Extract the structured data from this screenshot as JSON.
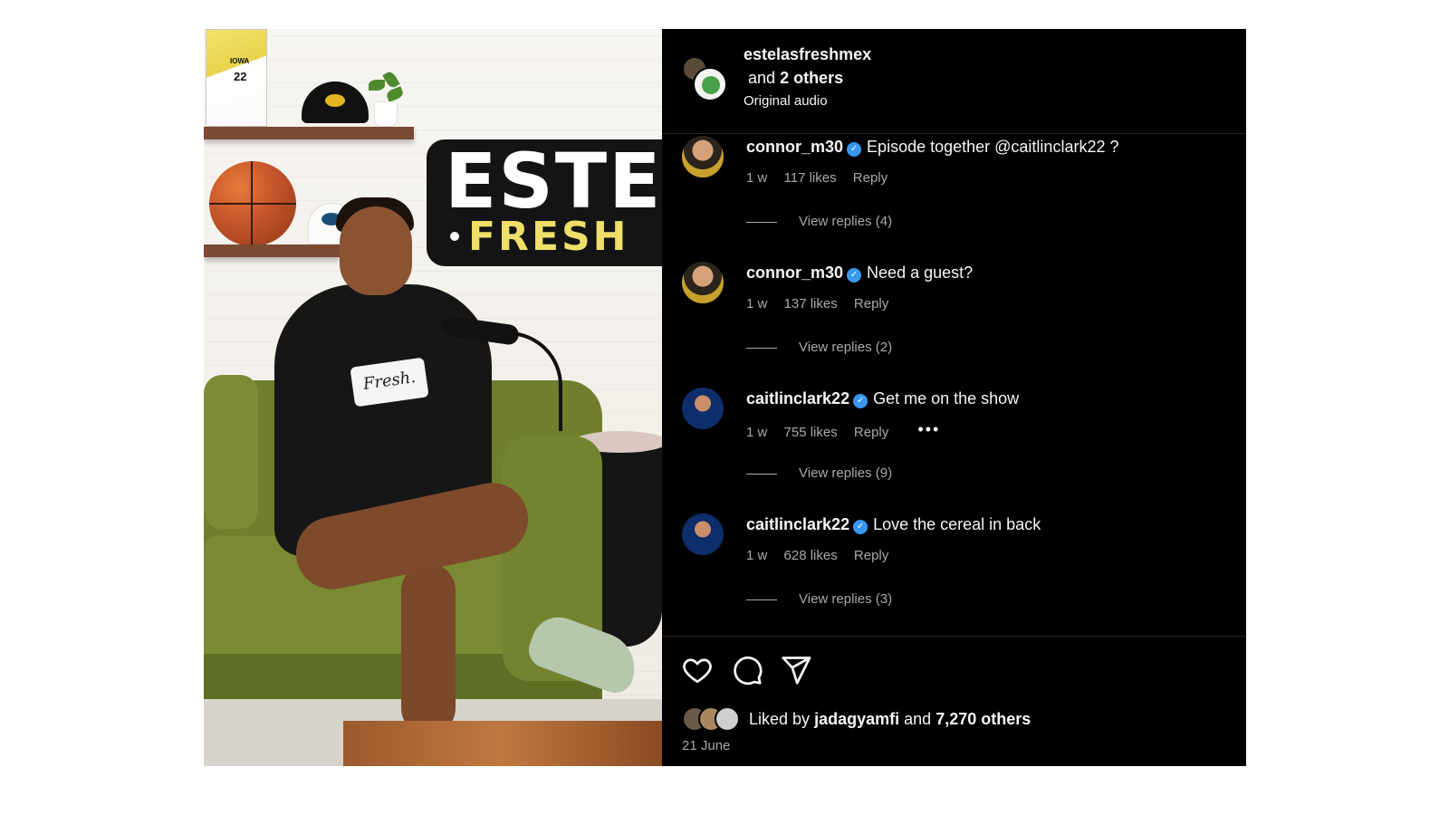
{
  "media": {
    "sign_big": "ESTE",
    "sign_small": "FRESH",
    "patch_text": "Fresh.",
    "magazine_number": "22",
    "magazine_team": "IOWA"
  },
  "post": {
    "author": "estelasfreshmex",
    "coauthors_prefix": "and",
    "coauthors_count": "2 others",
    "audio": "Original audio"
  },
  "comments": [
    {
      "user": "connor_m30",
      "text": "Episode together @caitlinclark22 ?",
      "age": "1 w",
      "likes": "117 likes",
      "reply_label": "Reply",
      "replies": "View replies (4)"
    },
    {
      "user": "connor_m30",
      "text": "Need a guest?",
      "age": "1 w",
      "likes": "137 likes",
      "reply_label": "Reply",
      "replies": "View replies (2)"
    },
    {
      "user": "caitlinclark22",
      "text": "Get me on the show",
      "age": "1 w",
      "likes": "755 likes",
      "reply_label": "Reply",
      "more": "•••",
      "replies": "View replies (9)"
    },
    {
      "user": "caitlinclark22",
      "text": "Love the cereal in back",
      "age": "1 w",
      "likes": "628 likes",
      "reply_label": "Reply",
      "replies": "View replies (3)"
    }
  ],
  "footer": {
    "liked_by_prefix": "Liked by",
    "liked_by_user": "jadagyamfi",
    "liked_by_and": "and",
    "liked_by_count": "7,270 others",
    "date": "21 June"
  },
  "icons": {
    "like": "heart-icon",
    "comment": "comment-icon",
    "share": "send-icon",
    "verified": "verified-badge-icon"
  },
  "colors": {
    "panel_bg": "#000000",
    "text_primary": "#f5f5f5",
    "text_secondary": "#a8a8a8",
    "verified": "#3897f0"
  }
}
